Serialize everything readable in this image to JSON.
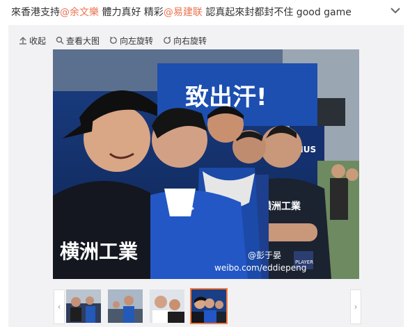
{
  "post": {
    "text_1": "來香港支持",
    "mention_1": "@余文樂",
    "text_2": " 體力真好 精彩",
    "mention_2": "@易建联",
    "text_3": " 認真起來封都封不住 good game"
  },
  "toolbar": {
    "collapse_label": "收起",
    "view_large_label": "查看大图",
    "rotate_left_label": "向左旋转",
    "rotate_right_label": "向右旋转"
  },
  "photo": {
    "watermark_name": "@彭于晏",
    "watermark_url": "weibo.com/eddiepeng",
    "banner_text": "致出汗!",
    "shirt_text": "横洲工業",
    "brand_text": "RIUS",
    "badge_text": "PLAYER"
  },
  "thumbnails": {
    "selected_index": 4,
    "count": 4
  },
  "colors": {
    "mention": "#eb7350",
    "selected_thumb": "#fa7d3c",
    "media_bg": "#f2f2f5"
  }
}
